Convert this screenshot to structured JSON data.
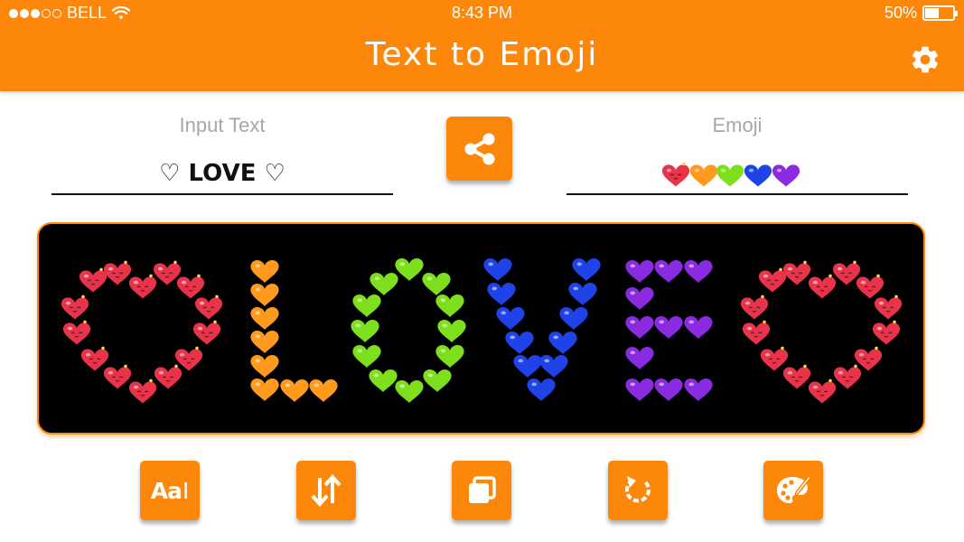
{
  "status_bar": {
    "carrier": "BELL",
    "signal_bars_on": 3,
    "signal_bars_total": 5,
    "time": "8:43 PM",
    "battery_percent": "50%",
    "battery_level": 0.5
  },
  "header": {
    "title": "Text to Emoji",
    "settings_icon": "gear-icon"
  },
  "input": {
    "label": "Input Text",
    "value": "♡ LOVE ♡"
  },
  "output": {
    "label": "Emoji",
    "value_icons": [
      "heart-face-red",
      "heart-orange",
      "heart-green",
      "heart-blue",
      "heart-purple"
    ]
  },
  "share_button": {
    "icon": "share-icon"
  },
  "preview": {
    "text": "♡LOVE♡",
    "letter_colors": [
      "#e8334a",
      "#ff9a1e",
      "#7ee01c",
      "#1f43e8",
      "#8a2be2",
      "#e8334a"
    ],
    "background": "#000000"
  },
  "toolbar": {
    "buttons": [
      {
        "name": "font-button",
        "icon": "font-icon",
        "label": "Aa"
      },
      {
        "name": "direction-button",
        "icon": "swap-vertical-icon"
      },
      {
        "name": "copy-button",
        "icon": "copy-icon"
      },
      {
        "name": "rotate-button",
        "icon": "rotate-icon"
      },
      {
        "name": "color-button",
        "icon": "palette-icon"
      }
    ]
  },
  "colors": {
    "accent": "#fd870b",
    "text_muted": "#a7a7a7"
  }
}
